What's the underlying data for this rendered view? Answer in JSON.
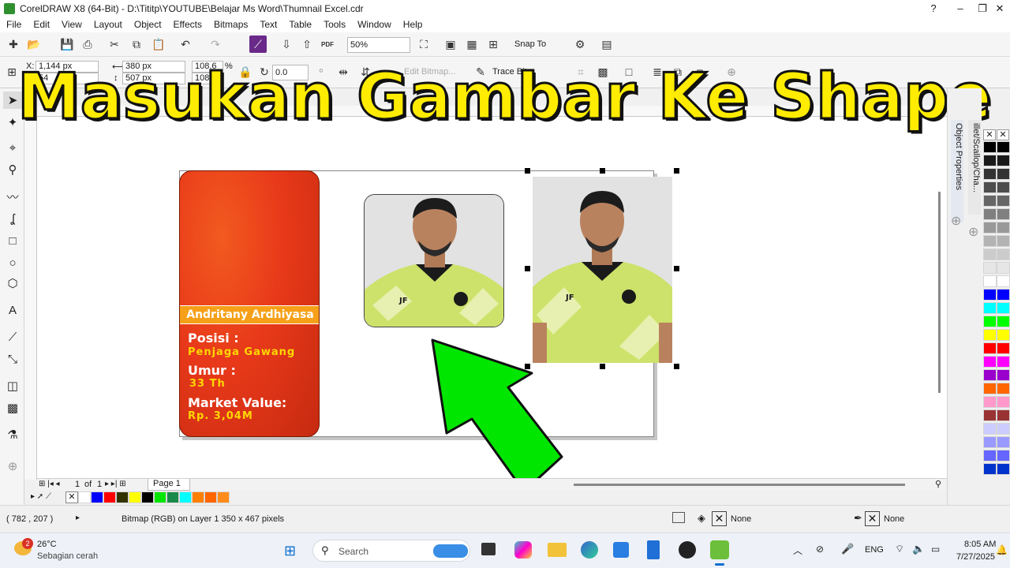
{
  "window": {
    "title": "CorelDRAW X8 (64-Bit) - D:\\Tititp\\YOUTUBE\\Belajar Ms Word\\Thumnail Excel.cdr",
    "controls": [
      "?",
      "–",
      "❐",
      "✕"
    ]
  },
  "menu": [
    "File",
    "Edit",
    "View",
    "Layout",
    "Object",
    "Effects",
    "Bitmaps",
    "Text",
    "Table",
    "Tools",
    "Window",
    "Help"
  ],
  "toolbar": {
    "zoom": "50%",
    "snap_to": "Snap To",
    "pdf": "PDF"
  },
  "property_bar": {
    "x_label": "X:",
    "x": "1,144 px",
    "y_label": "Y:",
    "y": "54",
    "width": "380 px",
    "height": "507 px",
    "scale_w": "108.6",
    "scale_h": "108.6",
    "percent": "%",
    "rotation": "0.0",
    "edit_bitmap": "Edit Bitmap...",
    "trace_bitmap": "Trace Bit"
  },
  "headline": "Masukan Gambar Ke Shape",
  "card": {
    "name": "Andritany Ardhiyasa",
    "position_label": "Posisi :",
    "position_value": "Penjaga Gawang",
    "age_label": "Umur :",
    "age_value": "33 Th",
    "market_label": "Market Value:",
    "market_value": "Rp. 3,04M"
  },
  "docker": {
    "tab1": "Object Properties",
    "tab2": "illet/Scallop/Cha..."
  },
  "pages": {
    "current": "1",
    "of": "of",
    "total": "1",
    "tab": "Page 1"
  },
  "status": {
    "coords": "( 782 , 207 )",
    "info": "Bitmap (RGB) on Layer 1 350 x 467 pixels",
    "fill": "None",
    "outline": "None"
  },
  "taskbar": {
    "weather_temp": "26°C",
    "weather_desc": "Sebagian cerah",
    "weather_badge": "2",
    "search": "Search",
    "lang": "ENG",
    "time": "8:05 AM",
    "date": "7/27/2025"
  },
  "colors": {
    "card_red": "#e8391a",
    "card_orange": "#f6a019",
    "arrow_green": "#00e600",
    "headline_yellow": "#ffec00",
    "jersey_green": "#cde26a"
  },
  "palette_colors": [
    "#000000",
    "#1a1a1a",
    "#333333",
    "#4d4d4d",
    "#666666",
    "#808080",
    "#999999",
    "#b3b3b3",
    "#cccccc",
    "#e6e6e6",
    "#ffffff",
    "#0000ff",
    "#00ffff",
    "#00ff00",
    "#ffff00",
    "#ff0000",
    "#ff00ff",
    "#9900cc",
    "#ff6600",
    "#ff99cc",
    "#993333",
    "#ccccff",
    "#9999ff",
    "#6666ff",
    "#0033cc"
  ],
  "doc_palette_colors": [
    "#ffffff",
    "#0000ff",
    "#ff0000",
    "#333300",
    "#ffff00",
    "#000000",
    "#00e600",
    "#1a8a4a",
    "#00ffff",
    "#ff7f00",
    "#ff6600",
    "#ff8c1a"
  ]
}
